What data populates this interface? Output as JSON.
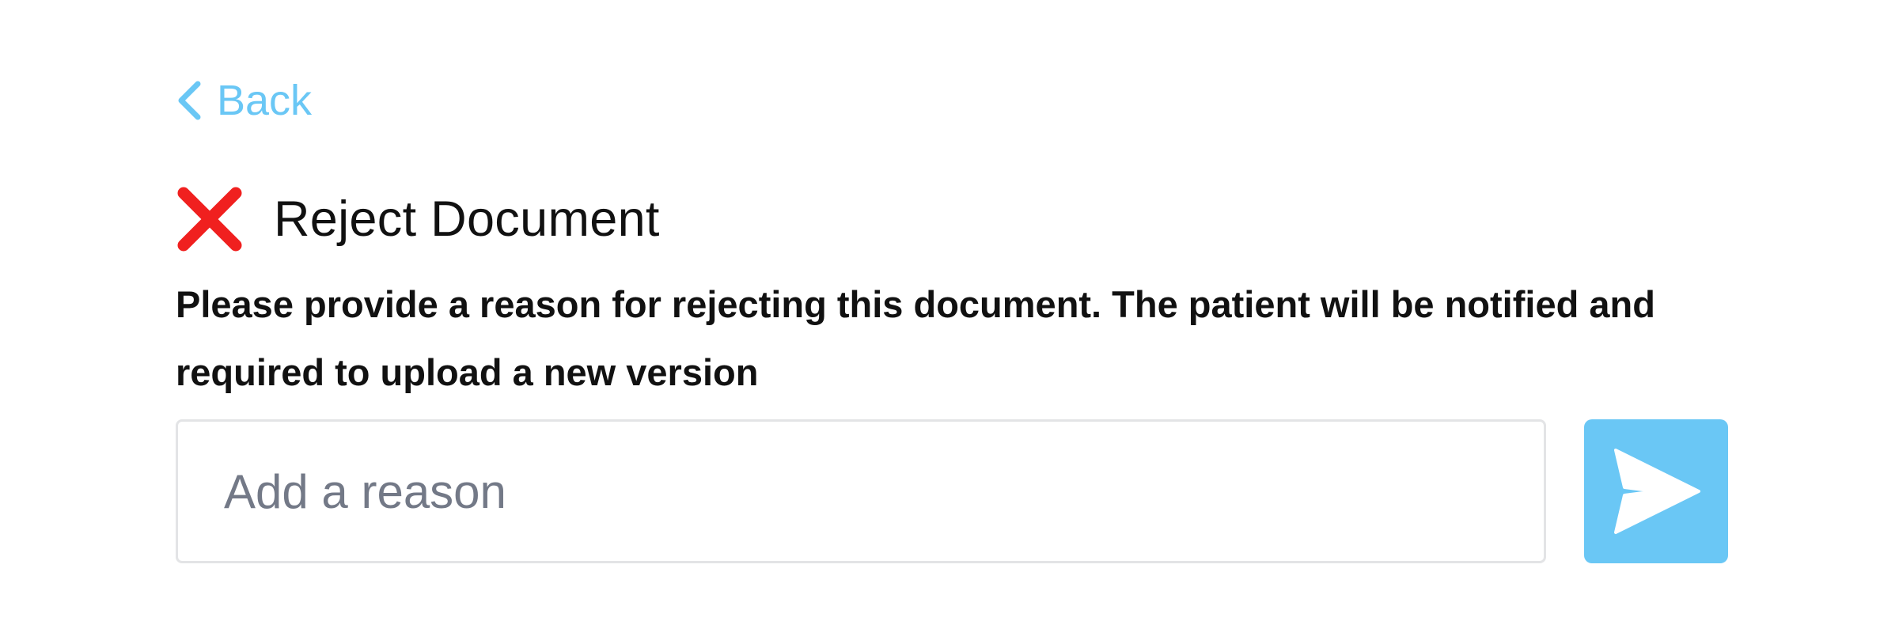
{
  "back": {
    "label": "Back",
    "icon": "chevron-left-icon"
  },
  "header": {
    "icon": "cross-mark-icon",
    "title": "Reject Document"
  },
  "description": "Please provide a reason for rejecting this document. The patient will be notified and required to upload a new version",
  "reason_input": {
    "value": "",
    "placeholder": "Add a reason"
  },
  "send_button": {
    "icon": "send-icon"
  },
  "colors": {
    "accent": "#6ac7f5",
    "danger": "#f0201f",
    "text": "#111111",
    "placeholder": "#737987",
    "border": "#e3e4e6"
  }
}
